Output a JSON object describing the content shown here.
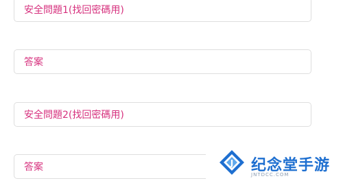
{
  "form": {
    "fields": [
      {
        "placeholder": "安全問題1(找回密碼用)"
      },
      {
        "placeholder": "答案"
      },
      {
        "placeholder": "安全問題2(找回密碼用)"
      },
      {
        "placeholder": "答案"
      }
    ],
    "placeholder_color": "#d6307d"
  },
  "watermark": {
    "title": "纪念堂手游",
    "subtitle": "JNTDCC.COM",
    "icon": "j-logo-icon",
    "accent": "#1e6fd0"
  }
}
